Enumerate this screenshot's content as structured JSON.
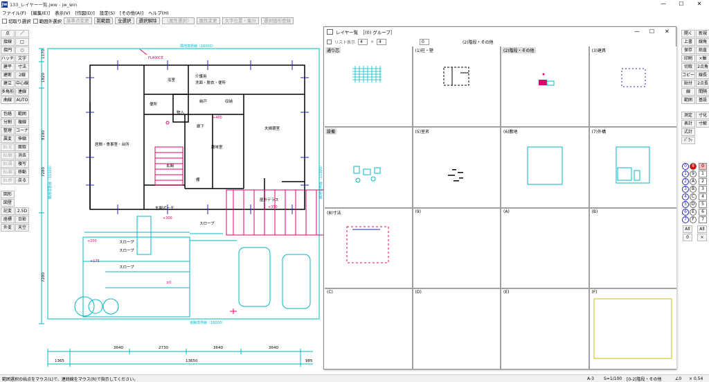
{
  "window": {
    "title": "133_レイヤー一覧.jww - jw_win",
    "controls": [
      "—",
      "☐",
      "✕"
    ]
  },
  "menu": [
    "ファイル(F)",
    "[編集(E)]",
    "表示(V)",
    "[作図(D)]",
    "設定(S)",
    "[その他(A)]",
    "ヘルプ(H)"
  ],
  "toolbar": {
    "cut_select": "切取り選択",
    "range_outside": "範囲外選択",
    "base_change": "基準点変更",
    "prev_range": "前範囲",
    "select_all": "全選択",
    "deselect": "選択解除",
    "attr_select": "〈属性選択〉",
    "attr_change": "属性変更",
    "char_pos": "文字位置・集計",
    "sel_figure": "選択図形登録"
  },
  "left_palette": [
    [
      "点",
      "／"
    ],
    [
      "接線",
      "□"
    ],
    [
      "接円",
      "○"
    ],
    [
      "ハッチ",
      "文字"
    ],
    [
      "建平",
      "寸法"
    ],
    [
      "建断",
      "2線"
    ],
    [
      "建立",
      "中心線"
    ],
    [
      "多角形",
      "連線"
    ],
    [
      "曲線",
      "AUTO"
    ],
    [
      "包絡",
      "範囲"
    ],
    [
      "分割",
      "複線"
    ],
    [
      "整理",
      "コーナー"
    ],
    [
      "属変",
      "伸縮"
    ],
    [
      "BL化",
      "面取"
    ],
    [
      "BL解",
      "消去"
    ],
    [
      "BL属",
      "複写"
    ],
    [
      "BL編",
      "移動"
    ],
    [
      "BL終",
      "戻る"
    ],
    [
      "図形",
      ""
    ],
    [
      "図登",
      ""
    ],
    [
      "記変",
      "2.5D"
    ],
    [
      "座標",
      "日影"
    ],
    [
      "外変",
      "天空"
    ]
  ],
  "right_palette": [
    [
      "新規",
      "開く"
    ],
    [
      "線角",
      "上書"
    ],
    [
      "鉛直",
      "保存"
    ],
    [
      "×軸",
      "印刷"
    ],
    [
      "2点角",
      "切取"
    ],
    [
      "線長",
      "コピー"
    ],
    [
      "2点長",
      "貼付"
    ],
    [
      "間隔",
      "線"
    ],
    [
      "基設",
      "範囲"
    ],
    [
      "寸化",
      "測定"
    ],
    [
      "寸解",
      "表計"
    ],
    [
      "",
      "式計"
    ],
    [
      "",
      "ﾊﾟﾗｯ"
    ]
  ],
  "layer_buttons": {
    "rows": [
      [
        "0",
        "8",
        "0"
      ],
      [
        "1",
        "9",
        "1"
      ],
      [
        "2",
        "A",
        "2"
      ],
      [
        "3",
        "B",
        "3"
      ],
      [
        "4",
        "C",
        "4"
      ],
      [
        "5",
        "D",
        "5"
      ],
      [
        "6",
        "E",
        "6"
      ],
      [
        "7",
        "F",
        "7"
      ]
    ],
    "all": "All",
    "zero": "0",
    "cross": "×"
  },
  "layer_window": {
    "title": "レイヤ一覧　［(0) グループ］",
    "list_display": "リスト表示",
    "cols": "4",
    "rows": "4",
    "times": "×",
    "group": "0",
    "group_label": "(2)階段・その他",
    "cells": [
      "通り芯",
      "(1)柱・壁",
      "(2)階段・その他",
      "(3)建具",
      "設備",
      "(5)室名",
      "(6)敷地",
      "(7)外構",
      "(8)寸法",
      "(9)",
      "(A)",
      "(B)",
      "(C)",
      "(D)",
      "(E)",
      "(F)"
    ]
  },
  "floor_plan": {
    "rooms": [
      "浴室",
      "介護用",
      "洗面・脱衣・便所",
      "便所",
      "納戸",
      "収納",
      "物入",
      "廊下",
      "夫婦寝室",
      "居間・食事室・台所",
      "玄関",
      "趣味室",
      "棚",
      "屋外テラス",
      "玄関ポーチ",
      "スロープ",
      "スロープ",
      "スロープ",
      "スロープ"
    ],
    "tags": [
      "+400",
      "+350",
      "+300",
      "+200",
      "+175",
      "±0",
      "FL400CE"
    ],
    "boundary_top": "隣地境界線（16000）",
    "boundary_bottom": "道路境界線（16000）",
    "boundary_left": "隣地境界線（11000）",
    "boundary_right": "隣地境界線（11000）",
    "dims_left": [
      "1170",
      "1820",
      "8190",
      "7280",
      "7280"
    ],
    "dims_bottom": [
      "1365",
      "3640",
      "2730",
      "3640",
      "3640",
      "13650",
      "985"
    ]
  },
  "status": {
    "message": "範囲選択の始点をマウス(L)で、連続線をマウス(R)で指示してください。",
    "paper": "A-3",
    "scale": "S=1/100",
    "layer": "[0-2]階段・その他",
    "angle": "∠0",
    "zoom": "× 0.54"
  },
  "colors": {
    "cyan": "#00b8c8",
    "blue": "#2020c0",
    "magenta": "#e0006a",
    "black": "#000000"
  }
}
